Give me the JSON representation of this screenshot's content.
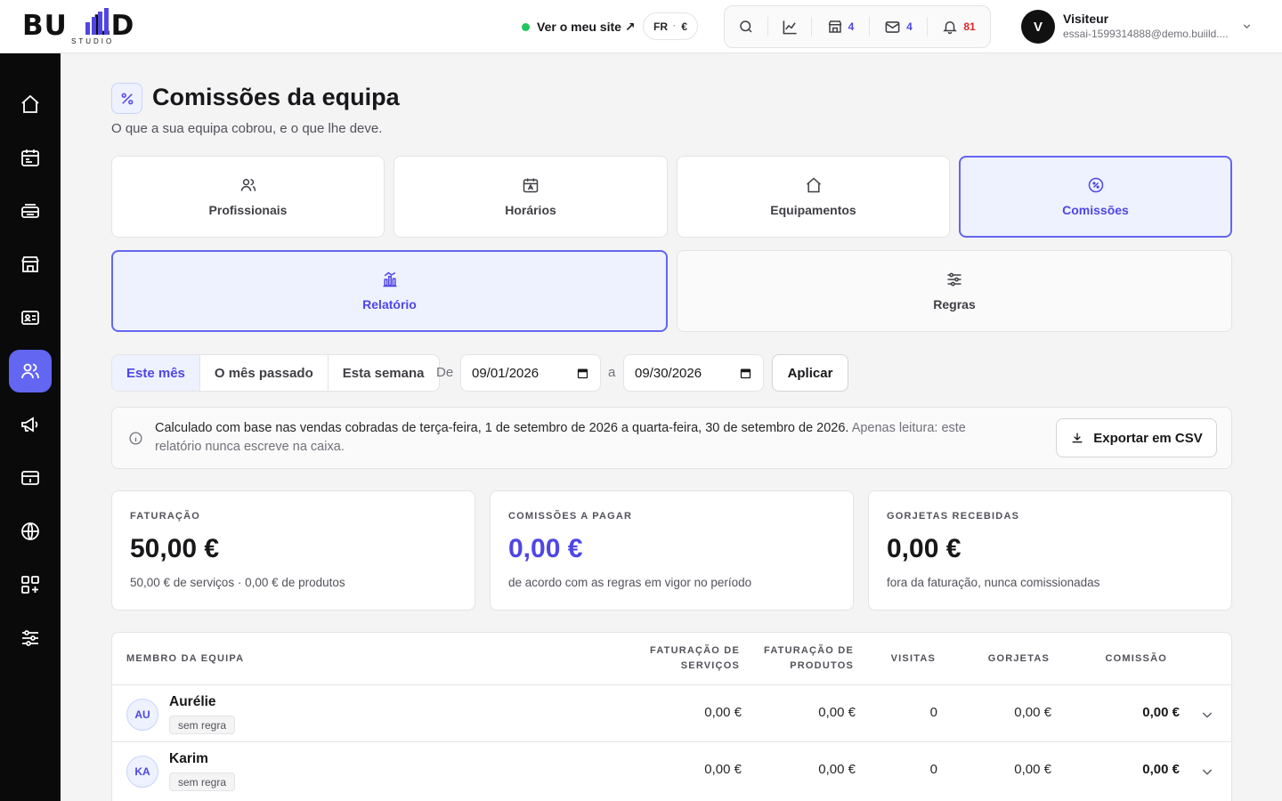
{
  "brand": {
    "logo_left": "BU",
    "logo_right": "LD",
    "logo_sub": "STUDIO"
  },
  "topbar": {
    "site_link": "Ver o meu site ↗",
    "lang": "FR",
    "currency": "€",
    "shop_count": "4",
    "mail_count": "4",
    "notif_count": "81"
  },
  "user": {
    "initial": "V",
    "name": "Visiteur",
    "email": "essai-1599314888@demo.buiild...."
  },
  "sidebar": {
    "items": [
      {
        "icon": "home-icon"
      },
      {
        "icon": "calendar-icon"
      },
      {
        "icon": "inbox-stack-icon"
      },
      {
        "icon": "store-icon"
      },
      {
        "icon": "contact-card-icon"
      },
      {
        "icon": "team-icon",
        "active": true
      },
      {
        "icon": "megaphone-icon"
      },
      {
        "icon": "payment-card-icon"
      },
      {
        "icon": "globe-icon"
      },
      {
        "icon": "apps-add-icon"
      },
      {
        "icon": "sliders-icon"
      }
    ]
  },
  "page": {
    "title": "Comissões da equipa",
    "subtitle": "O que a sua equipa cobrou, e o que lhe deve."
  },
  "tabs": [
    "Profissionais",
    "Horários",
    "Equipamentos",
    "Comissões"
  ],
  "subtabs": [
    "Relatório",
    "Regras"
  ],
  "filters": {
    "ranges": [
      "Este mês",
      "O mês passado",
      "Esta semana"
    ],
    "from_label": "De",
    "from_value": "09/01/2026",
    "to_label": "a",
    "to_value": "09/30/2026",
    "apply": "Aplicar"
  },
  "info": {
    "text": "Calculado com base nas vendas cobradas de terça-feira, 1 de setembro de 2026 a quarta-feira, 30 de setembro de 2026.",
    "muted": "Apenas leitura: este relatório nunca escreve na caixa.",
    "export": "Exportar em CSV"
  },
  "stats": [
    {
      "label": "FATURAÇÃO",
      "value": "50,00 €",
      "note": "50,00 € de serviços · 0,00 € de produtos"
    },
    {
      "label": "COMISSÕES A PAGAR",
      "value": "0,00 €",
      "note": "de acordo com as regras em vigor no período"
    },
    {
      "label": "GORJETAS RECEBIDAS",
      "value": "0,00 €",
      "note": "fora da faturação, nunca comissionadas"
    }
  ],
  "table": {
    "headers": {
      "member": "MEMBRO DA EQUIPA",
      "services_1": "FATURAÇÃO DE",
      "services_2": "SERVIÇOS",
      "products_1": "FATURAÇÃO DE",
      "products_2": "PRODUTOS",
      "visits": "VISITAS",
      "tips": "GORJETAS",
      "commission": "COMISSÃO"
    },
    "rows": [
      {
        "initials": "AU",
        "name": "Aurélie",
        "badge": "sem regra",
        "services": "0,00 €",
        "products": "0,00 €",
        "visits": "0",
        "tips": "0,00 €",
        "commission": "0,00 €"
      },
      {
        "initials": "KA",
        "name": "Karim",
        "badge": "sem regra",
        "services": "0,00 €",
        "products": "0,00 €",
        "visits": "0",
        "tips": "0,00 €",
        "commission": "0,00 €"
      }
    ]
  },
  "colors": {
    "accent": "#6366f1",
    "accent_text": "#4f46e5",
    "sidebar": "#0a0a0a",
    "online": "#22c55e",
    "alert": "#dc2626"
  }
}
